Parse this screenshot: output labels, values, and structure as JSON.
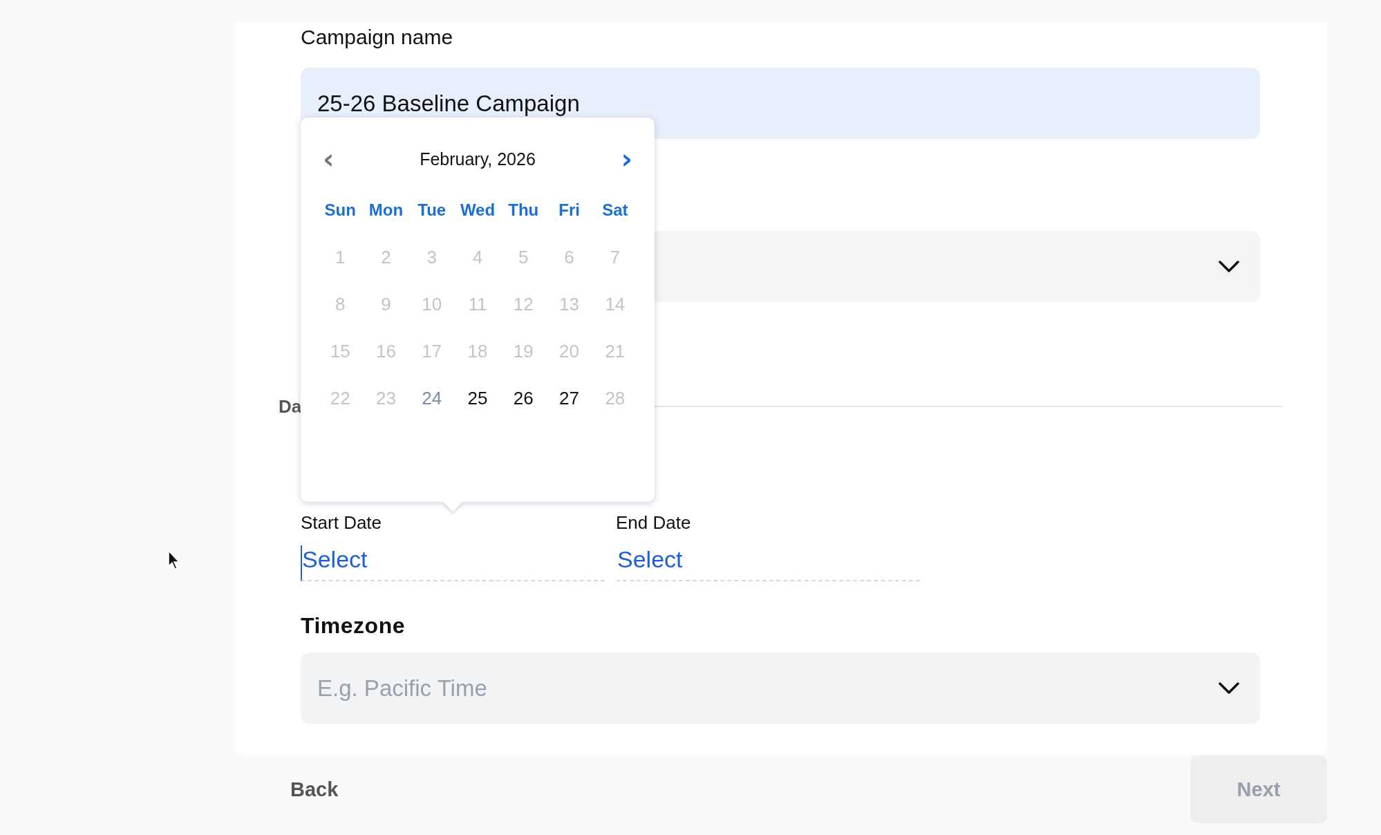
{
  "campaign_name": {
    "label": "Campaign name",
    "value": "25-26 Baseline Campaign"
  },
  "dropdown": {
    "expanded": false
  },
  "section_heading": "Da",
  "date_range": {
    "start": {
      "label": "Start Date",
      "value": "Select",
      "focused": true
    },
    "end": {
      "label": "End Date",
      "value": "Select",
      "focused": false
    }
  },
  "timezone": {
    "label": "Timezone",
    "placeholder": "E.g. Pacific Time",
    "expanded": false
  },
  "calendar": {
    "month": "February, 2026",
    "prev": "‹",
    "next": "›",
    "prev_disabled": true,
    "weekdays": [
      "Sun",
      "Mon",
      "Tue",
      "Wed",
      "Thu",
      "Fri",
      "Sat"
    ],
    "weeks": [
      [
        {
          "day": "1",
          "kind": "disabled"
        },
        {
          "day": "2",
          "kind": "disabled"
        },
        {
          "day": "3",
          "kind": "disabled"
        },
        {
          "day": "4",
          "kind": "disabled"
        },
        {
          "day": "5",
          "kind": "disabled"
        },
        {
          "day": "6",
          "kind": "disabled"
        },
        {
          "day": "7",
          "kind": "disabled"
        }
      ],
      [
        {
          "day": "8",
          "kind": "disabled"
        },
        {
          "day": "9",
          "kind": "disabled"
        },
        {
          "day": "10",
          "kind": "disabled"
        },
        {
          "day": "11",
          "kind": "disabled"
        },
        {
          "day": "12",
          "kind": "disabled"
        },
        {
          "day": "13",
          "kind": "disabled"
        },
        {
          "day": "14",
          "kind": "disabled"
        }
      ],
      [
        {
          "day": "15",
          "kind": "disabled"
        },
        {
          "day": "16",
          "kind": "disabled"
        },
        {
          "day": "17",
          "kind": "disabled"
        },
        {
          "day": "18",
          "kind": "disabled"
        },
        {
          "day": "19",
          "kind": "disabled"
        },
        {
          "day": "20",
          "kind": "disabled"
        },
        {
          "day": "21",
          "kind": "disabled"
        }
      ],
      [
        {
          "day": "22",
          "kind": "disabled"
        },
        {
          "day": "23",
          "kind": "disabled"
        },
        {
          "day": "24",
          "kind": "today"
        },
        {
          "day": "25",
          "kind": "available"
        },
        {
          "day": "26",
          "kind": "available"
        },
        {
          "day": "27",
          "kind": "available"
        },
        {
          "day": "28",
          "kind": "disabled"
        }
      ]
    ]
  },
  "footer": {
    "back": "Back",
    "next": {
      "label": "Next",
      "disabled": true
    }
  }
}
